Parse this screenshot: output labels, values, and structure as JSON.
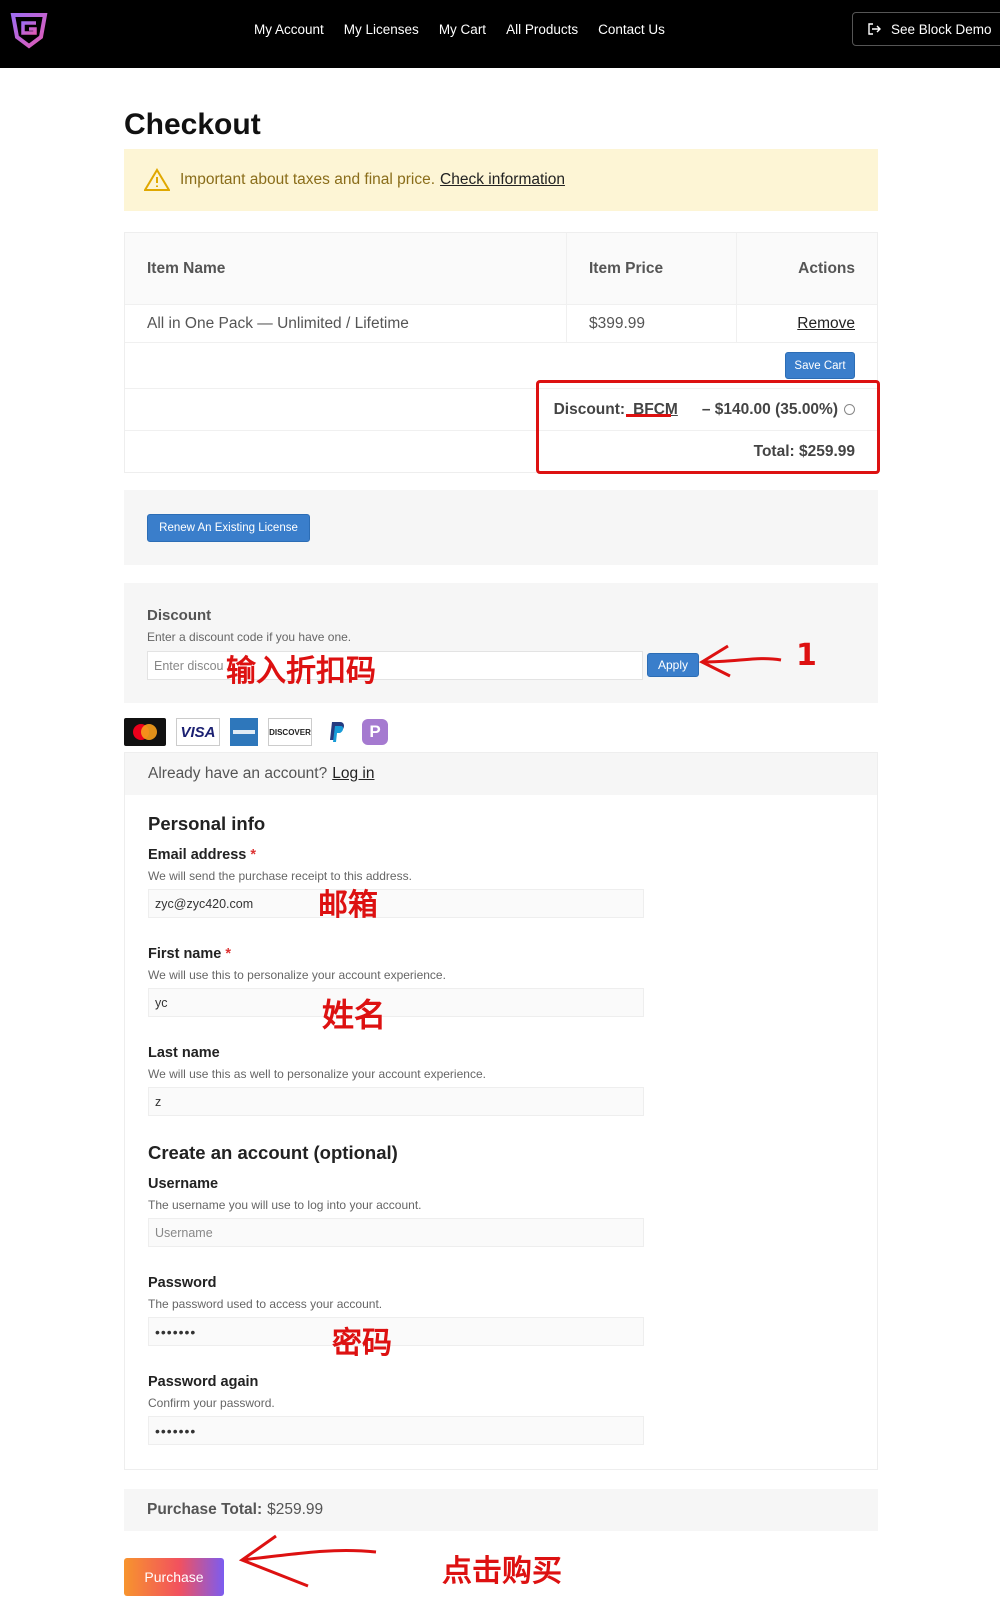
{
  "nav": [
    "My Account",
    "My Licenses",
    "My Cart",
    "All Products",
    "Contact Us"
  ],
  "header": {
    "demo_label": "See Block Demo"
  },
  "page": {
    "title": "Checkout"
  },
  "notice": {
    "text": "Important about taxes and final price.",
    "link": "Check information"
  },
  "cart": {
    "col_item": "Item Name",
    "col_price": "Item Price",
    "col_actions": "Actions",
    "item_name": "All in One Pack — Unlimited / Lifetime",
    "item_price": "$399.99",
    "remove_label": "Remove",
    "save_label": "Save Cart",
    "discount_label": "Discount:",
    "discount_code": "BFCM",
    "discount_amount": "– $140.00 (35.00%)",
    "total_label": "Total: $259.99"
  },
  "renew": {
    "label": "Renew An Existing License"
  },
  "discount": {
    "title": "Discount",
    "desc": "Enter a discount code if you have one.",
    "placeholder": "Enter discou",
    "apply_label": "Apply"
  },
  "annotations": {
    "discount_cn": "输入折扣码",
    "step": "1",
    "email_cn": "邮箱",
    "name_cn": "姓名",
    "password_cn": "密码",
    "purchase_cn": "点击购买"
  },
  "payment_icons": [
    "mastercard-icon",
    "visa-icon",
    "amex-icon",
    "discover-icon",
    "paypal-icon",
    "p-icon"
  ],
  "payment_text": {
    "visa": "VISA",
    "discover": "DISCOVER",
    "p": "P"
  },
  "login": {
    "text": "Already have an account?",
    "link": "Log in"
  },
  "personal": {
    "title": "Personal info",
    "email_label": "Email address",
    "email_desc": "We will send the purchase receipt to this address.",
    "email_value": "zyc@zyc420.com",
    "first_label": "First name",
    "first_desc": "We will use this to personalize your account experience.",
    "first_value": "yc",
    "last_label": "Last name",
    "last_desc": "We will use this as well to personalize your account experience.",
    "last_value": "z",
    "required_mark": "*"
  },
  "account": {
    "title": "Create an account (optional)",
    "username_label": "Username",
    "username_desc": "The username you will use to log into your account.",
    "username_placeholder": "Username",
    "password_label": "Password",
    "password_desc": "The password used to access your account.",
    "password_value": "•••••••",
    "password2_label": "Password again",
    "password2_desc": "Confirm your password.",
    "password2_value": "•••••••"
  },
  "purchase": {
    "total_label": "Purchase Total:",
    "total_value": "$259.99",
    "button_label": "Purchase"
  },
  "colors": {
    "accent": "#3a7ecb",
    "annotation": "#dd1111",
    "notice_bg": "#fdf5d5"
  }
}
